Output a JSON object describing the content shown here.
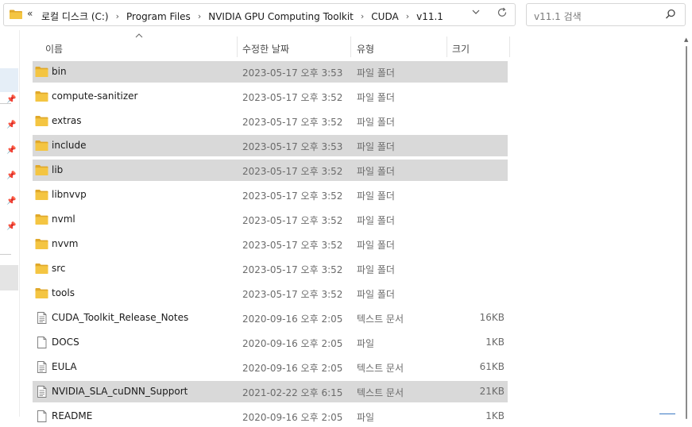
{
  "address_bar": {
    "overflow": "«",
    "crumbs": [
      "로컬 디스크 (C:)",
      "Program Files",
      "NVIDIA GPU Computing Toolkit",
      "CUDA",
      "v11.1"
    ],
    "separator": "›"
  },
  "search": {
    "placeholder": "v11.1 검색"
  },
  "columns": {
    "name": "이름",
    "date": "수정한 날짜",
    "type": "유형",
    "size": "크기"
  },
  "files": [
    {
      "name": "bin",
      "date": "2023-05-17 오후 3:53",
      "type": "파일 폴더",
      "size": "",
      "icon": "folder-icon",
      "selected": true
    },
    {
      "name": "compute-sanitizer",
      "date": "2023-05-17 오후 3:52",
      "type": "파일 폴더",
      "size": "",
      "icon": "folder-icon",
      "selected": false
    },
    {
      "name": "extras",
      "date": "2023-05-17 오후 3:52",
      "type": "파일 폴더",
      "size": "",
      "icon": "folder-icon",
      "selected": false
    },
    {
      "name": "include",
      "date": "2023-05-17 오후 3:53",
      "type": "파일 폴더",
      "size": "",
      "icon": "folder-icon",
      "selected": true
    },
    {
      "name": "lib",
      "date": "2023-05-17 오후 3:52",
      "type": "파일 폴더",
      "size": "",
      "icon": "folder-icon",
      "selected": true
    },
    {
      "name": "libnvvp",
      "date": "2023-05-17 오후 3:52",
      "type": "파일 폴더",
      "size": "",
      "icon": "folder-icon",
      "selected": false
    },
    {
      "name": "nvml",
      "date": "2023-05-17 오후 3:52",
      "type": "파일 폴더",
      "size": "",
      "icon": "folder-icon",
      "selected": false
    },
    {
      "name": "nvvm",
      "date": "2023-05-17 오후 3:52",
      "type": "파일 폴더",
      "size": "",
      "icon": "folder-icon",
      "selected": false
    },
    {
      "name": "src",
      "date": "2023-05-17 오후 3:52",
      "type": "파일 폴더",
      "size": "",
      "icon": "folder-icon",
      "selected": false
    },
    {
      "name": "tools",
      "date": "2023-05-17 오후 3:52",
      "type": "파일 폴더",
      "size": "",
      "icon": "folder-icon",
      "selected": false
    },
    {
      "name": "CUDA_Toolkit_Release_Notes",
      "date": "2020-09-16 오후 2:05",
      "type": "텍스트 문서",
      "size": "16KB",
      "icon": "text-document-icon",
      "selected": false
    },
    {
      "name": "DOCS",
      "date": "2020-09-16 오후 2:05",
      "type": "파일",
      "size": "1KB",
      "icon": "file-icon",
      "selected": false
    },
    {
      "name": "EULA",
      "date": "2020-09-16 오후 2:05",
      "type": "텍스트 문서",
      "size": "61KB",
      "icon": "text-document-icon",
      "selected": false
    },
    {
      "name": "NVIDIA_SLA_cuDNN_Support",
      "date": "2021-02-22 오후 6:15",
      "type": "텍스트 문서",
      "size": "21KB",
      "icon": "text-document-icon",
      "selected": true
    },
    {
      "name": "README",
      "date": "2020-09-16 오후 2:05",
      "type": "파일",
      "size": "1KB",
      "icon": "file-icon",
      "selected": false
    }
  ],
  "colors": {
    "selection": "#d9d9d9",
    "folder": "#f4c542",
    "folder_dark": "#e0a82a",
    "nav_selected": "#e5eef7"
  }
}
